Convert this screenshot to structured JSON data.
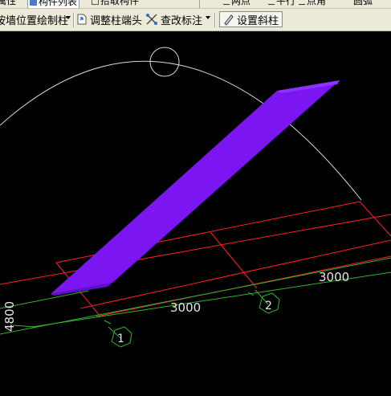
{
  "toolbar_top": {
    "items": [
      "属性",
      "构件列表",
      "拾取构件",
      "两点",
      "平行",
      "点角",
      "圆弧"
    ]
  },
  "toolbar": {
    "item1": "按墙位置绘制柱",
    "item2": "调整柱端头",
    "item3": "查改标注",
    "item4": "设置斜柱"
  },
  "canvas": {
    "dimensions": [
      "3000",
      "3000",
      "4800"
    ],
    "axis_labels": [
      "1",
      "2"
    ]
  },
  "colors": {
    "column": "#7b16f2",
    "grid_red": "#ff2020",
    "axis_green": "#2fb42f"
  }
}
